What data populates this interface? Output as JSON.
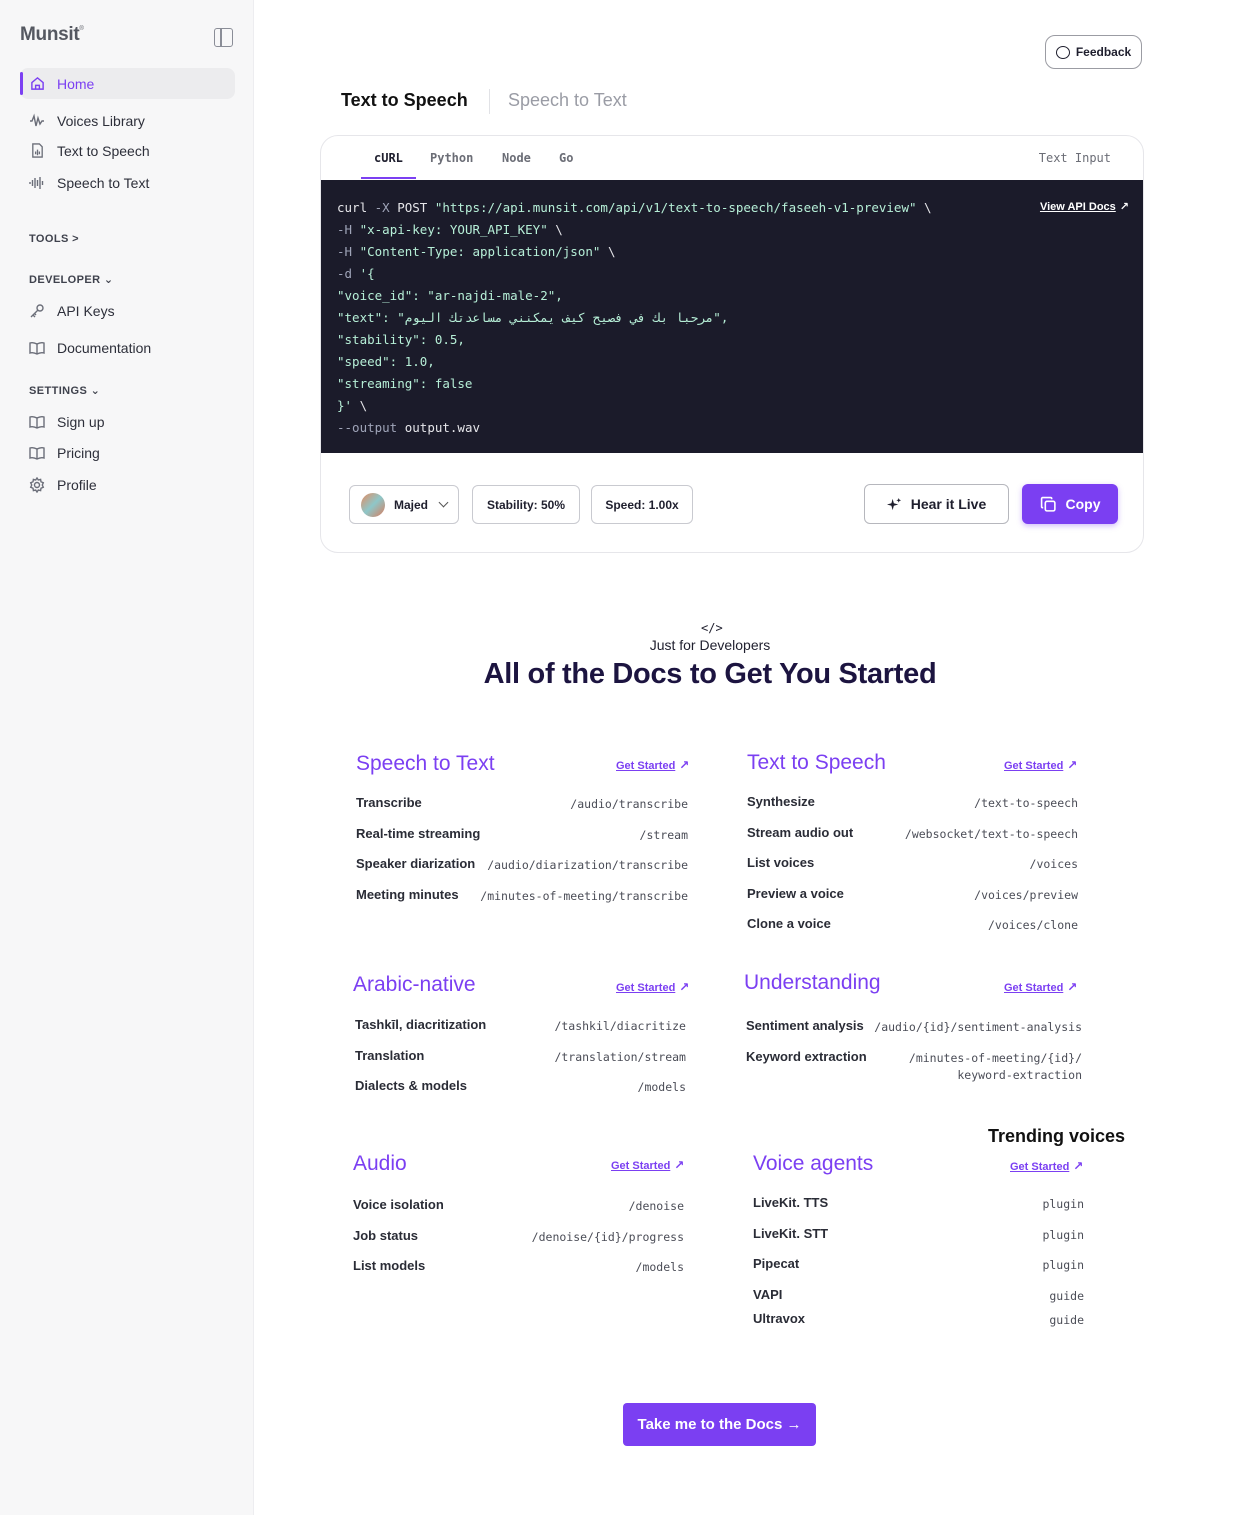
{
  "sidebar": {
    "logo": "Munsit",
    "logo_mark": "®",
    "items": [
      {
        "label": "Home",
        "icon": "home-icon"
      },
      {
        "label": "Voices Library",
        "icon": "waveform-icon"
      },
      {
        "label": "Text to Speech",
        "icon": "document-audio-icon"
      },
      {
        "label": "Speech to Text",
        "icon": "audio-bars-icon"
      }
    ],
    "tools_label": "TOOLS >",
    "developer_label": "DEVELOPER ⌄",
    "developer_items": [
      {
        "label": "API Keys",
        "icon": "key-icon"
      },
      {
        "label": "Documentation",
        "icon": "book-icon"
      }
    ],
    "settings_label": "SETTINGS ⌄",
    "settings_items": [
      {
        "label": "Sign up",
        "icon": "book-icon"
      },
      {
        "label": "Pricing",
        "icon": "book-icon"
      },
      {
        "label": "Profile",
        "icon": "gear-icon"
      }
    ]
  },
  "header": {
    "feedback_label": "Feedback",
    "tabs": [
      {
        "label": "Text to Speech",
        "active": true
      },
      {
        "label": "Speech to Text",
        "active": false
      }
    ]
  },
  "code_card": {
    "lang_tabs": [
      "cURL",
      "Python",
      "Node",
      "Go"
    ],
    "right_tab": "Text Input",
    "api_docs_link": "View API Docs",
    "lines": [
      {
        "a": "curl ",
        "f": "-X",
        "b": " POST ",
        "s": "\"https://api.munsit.com/api/v1/text-to-speech/faseeh-v1-preview\"",
        "c": " \\"
      },
      {
        "f": "-H",
        "b": " ",
        "s": "\"x-api-key: YOUR_API_KEY\"",
        "c": " \\"
      },
      {
        "f": "-H",
        "b": " ",
        "s": "\"Content-Type: application/json\"",
        "c": " \\"
      },
      {
        "f": "-d",
        "b": " ",
        "s": "'{"
      },
      {
        "s": "\"voice_id\": \"ar-najdi-male-2\","
      },
      {
        "s": "\"text\": \"مرحبا بك في فصيح كيف يمكنني مساعدتك اليوم\","
      },
      {
        "s": "\"stability\": 0.5,"
      },
      {
        "s": "\"speed\": 1.0,"
      },
      {
        "s": "\"streaming\": false"
      },
      {
        "s": "}'",
        "c": " \\"
      },
      {
        "f": "--output",
        "b": " output.wav"
      }
    ],
    "voice_name": "Majed",
    "stability": "Stability: 50%",
    "speed": "Speed: 1.00x",
    "hear_label": "Hear it Live",
    "copy_label": "Copy"
  },
  "developers": {
    "icon": "</>",
    "kicker": "Just for Developers",
    "title": "All of the Docs to Get You Started",
    "get_started": "Get Started",
    "groups": [
      {
        "title": "Speech to Text",
        "rows": [
          {
            "label": "Transcribe",
            "path": "/audio/transcribe"
          },
          {
            "label": "Real-time streaming",
            "path": "/stream"
          },
          {
            "label": "Speaker diarization",
            "path": "/audio/diarization/transcribe"
          },
          {
            "label": "Meeting minutes",
            "path": "/minutes-of-meeting/transcribe"
          }
        ]
      },
      {
        "title": "Text to Speech",
        "rows": [
          {
            "label": "Synthesize",
            "path": "/text-to-speech"
          },
          {
            "label": "Stream audio out",
            "path": "/websocket/text-to-speech"
          },
          {
            "label": "List voices",
            "path": "/voices"
          },
          {
            "label": "Preview a voice",
            "path": "/voices/preview"
          },
          {
            "label": "Clone a voice",
            "path": "/voices/clone"
          }
        ]
      },
      {
        "title": "Arabic-native",
        "rows": [
          {
            "label": "Tashkīl, diacritization",
            "path": "/tashkil/diacritize"
          },
          {
            "label": "Translation",
            "path": "/translation/stream"
          },
          {
            "label": "Dialects & models",
            "path": "/models"
          }
        ]
      },
      {
        "title": "Understanding",
        "rows": [
          {
            "label": "Sentiment analysis",
            "path": "/audio/{id}/sentiment-analysis"
          },
          {
            "label": "Keyword extraction",
            "path": "/minutes-of-meeting/{id}/\nkeyword-extraction"
          }
        ]
      },
      {
        "title": "Audio",
        "rows": [
          {
            "label": "Voice isolation",
            "path": "/denoise"
          },
          {
            "label": "Job status",
            "path": "/denoise/{id}/progress"
          },
          {
            "label": "List models",
            "path": "/models"
          }
        ]
      },
      {
        "title": "Voice agents",
        "rows": [
          {
            "label": "LiveKit. TTS",
            "path": "plugin"
          },
          {
            "label": "LiveKit. STT",
            "path": "plugin"
          },
          {
            "label": "Pipecat",
            "path": "plugin"
          },
          {
            "label": "VAPI",
            "path": "guide"
          },
          {
            "label": "Ultravox",
            "path": "guide"
          }
        ]
      }
    ],
    "trending": "Trending voices",
    "cta": "Take me to the Docs →"
  },
  "colors": {
    "accent": "#7b3ff2",
    "code_bg": "#1b1b2a",
    "heading": "#1c1440"
  }
}
